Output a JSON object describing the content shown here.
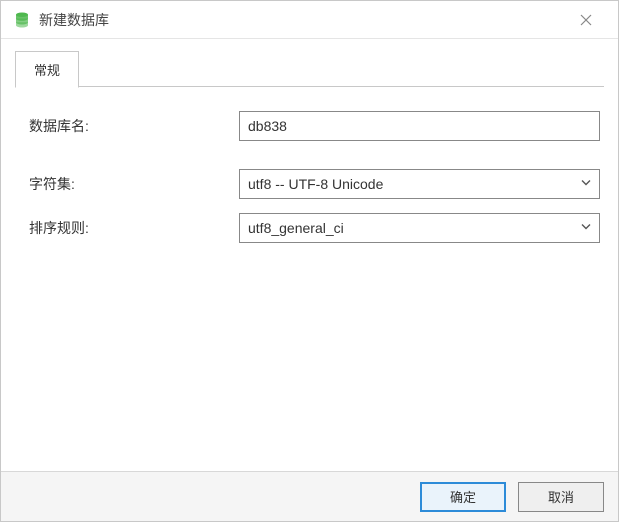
{
  "dialog": {
    "title": "新建数据库"
  },
  "tabs": {
    "general": "常规"
  },
  "form": {
    "dbname_label": "数据库名:",
    "dbname_value": "db838",
    "charset_label": "字符集:",
    "charset_value": "utf8 -- UTF-8 Unicode",
    "collation_label": "排序规则:",
    "collation_value": "utf8_general_ci"
  },
  "buttons": {
    "ok": "确定",
    "cancel": "取消"
  }
}
